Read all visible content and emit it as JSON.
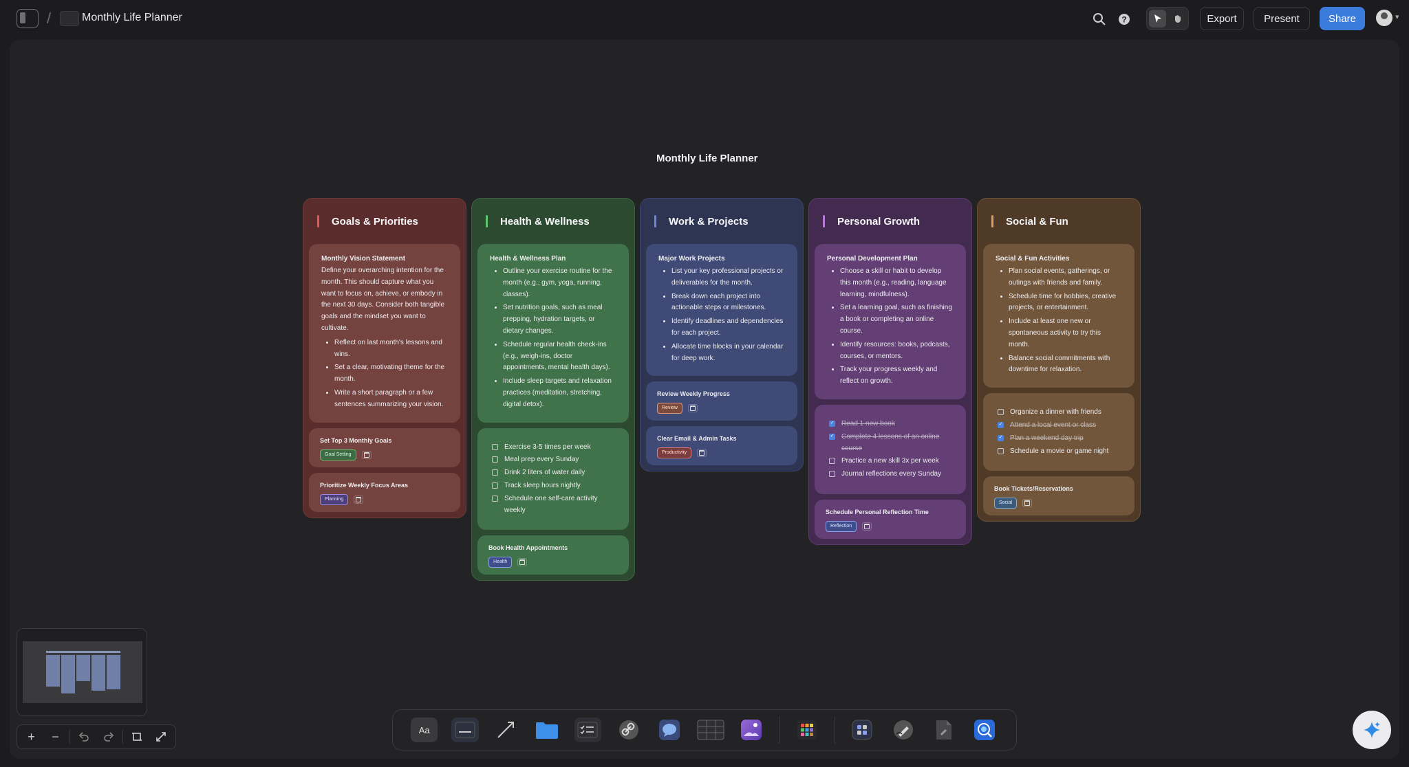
{
  "topbar": {
    "doc_title": "Monthly Life Planner",
    "export_label": "Export",
    "present_label": "Present",
    "share_label": "Share",
    "accent_color": "#3b7bdc"
  },
  "board": {
    "title": "Monthly Life Planner"
  },
  "columns": [
    {
      "title": "Goals & Priorities",
      "color": "#5a2d2c",
      "accent": "#e05a5a",
      "main_card": {
        "title": "Monthly Vision Statement",
        "text": "Define your overarching intention for the month. This should capture what you want to focus on, achieve, or embody in the next 30 days. Consider both tangible goals and the mindset you want to cultivate.",
        "items": [
          "Reflect on last month's lessons and wins.",
          "Set a clear, motivating theme for the month.",
          "Write a short paragraph or a few sentences summarizing your vision."
        ]
      },
      "tasks": [
        {
          "title": "Set Top 3 Monthly Goals",
          "tag": "Goal Setting"
        },
        {
          "title": "Prioritize Weekly Focus Areas",
          "tag": "Planning"
        }
      ]
    },
    {
      "title": "Health & Wellness",
      "color": "#2c4a30",
      "accent": "#5ec46e",
      "main_card": {
        "title": "Health & Wellness Plan",
        "items": [
          "Outline your exercise routine for the month (e.g., gym, yoga, running, classes).",
          "Set nutrition goals, such as meal prepping, hydration targets, or dietary changes.",
          "Schedule regular health check-ins (e.g., weigh-ins, doctor appointments, mental health days).",
          "Include sleep targets and relaxation practices (meditation, stretching, digital detox)."
        ]
      },
      "todos": [
        {
          "text": "Exercise 3-5 times per week",
          "done": false
        },
        {
          "text": "Meal prep every Sunday",
          "done": false
        },
        {
          "text": "Drink 2 liters of water daily",
          "done": false
        },
        {
          "text": "Track sleep hours nightly",
          "done": false
        },
        {
          "text": "Schedule one self-care activity weekly",
          "done": false
        }
      ],
      "tasks": [
        {
          "title": "Book Health Appointments",
          "tag": "Health"
        }
      ]
    },
    {
      "title": "Work & Projects",
      "color": "#2d3552",
      "accent": "#6d86d6",
      "main_card": {
        "title": "Major Work Projects",
        "items": [
          "List your key professional projects or deliverables for the month.",
          "Break down each project into actionable steps or milestones.",
          "Identify deadlines and dependencies for each project.",
          "Allocate time blocks in your calendar for deep work."
        ]
      },
      "tasks": [
        {
          "title": "Review Weekly Progress",
          "tag": "Review"
        },
        {
          "title": "Clear Email & Admin Tasks",
          "tag": "Productivity"
        }
      ]
    },
    {
      "title": "Personal Growth",
      "color": "#432a4f",
      "accent": "#b77ad6",
      "main_card": {
        "title": "Personal Development Plan",
        "items": [
          "Choose a skill or habit to develop this month (e.g., reading, language learning, mindfulness).",
          "Set a learning goal, such as finishing a book or completing an online course.",
          "Identify resources: books, podcasts, courses, or mentors.",
          "Track your progress weekly and reflect on growth."
        ]
      },
      "todos": [
        {
          "text": "Read 1 new book",
          "done": true
        },
        {
          "text": "Complete 4 lessons of an online course",
          "done": true
        },
        {
          "text": "Practice a new skill 3x per week",
          "done": false
        },
        {
          "text": "Journal reflections every Sunday",
          "done": false
        }
      ],
      "tasks": [
        {
          "title": "Schedule Personal Reflection Time",
          "tag": "Reflection"
        }
      ]
    },
    {
      "title": "Social & Fun",
      "color": "#4f3a27",
      "accent": "#e09a5a",
      "main_card": {
        "title": "Social & Fun Activities",
        "items": [
          "Plan social events, gatherings, or outings with friends and family.",
          "Schedule time for hobbies, creative projects, or entertainment.",
          "Include at least one new or spontaneous activity to try this month.",
          "Balance social commitments with downtime for relaxation."
        ]
      },
      "todos": [
        {
          "text": "Organize a dinner with friends",
          "done": false
        },
        {
          "text": "Attend a local event or class",
          "done": true
        },
        {
          "text": "Plan a weekend day trip",
          "done": true
        },
        {
          "text": "Schedule a movie or game night",
          "done": false
        }
      ],
      "tasks": [
        {
          "title": "Book Tickets/Reservations",
          "tag": "Social"
        }
      ]
    }
  ],
  "dock": {
    "items": [
      "text-tool-icon",
      "sticky-note-icon",
      "arrow-tool-icon",
      "folder-icon",
      "checklist-icon",
      "link-icon",
      "comment-icon",
      "table-icon",
      "image-icon",
      "apps-grid-icon",
      "widget-icon",
      "pen-icon",
      "document-icon",
      "browser-icon"
    ]
  },
  "text_tool_label": "Aa"
}
